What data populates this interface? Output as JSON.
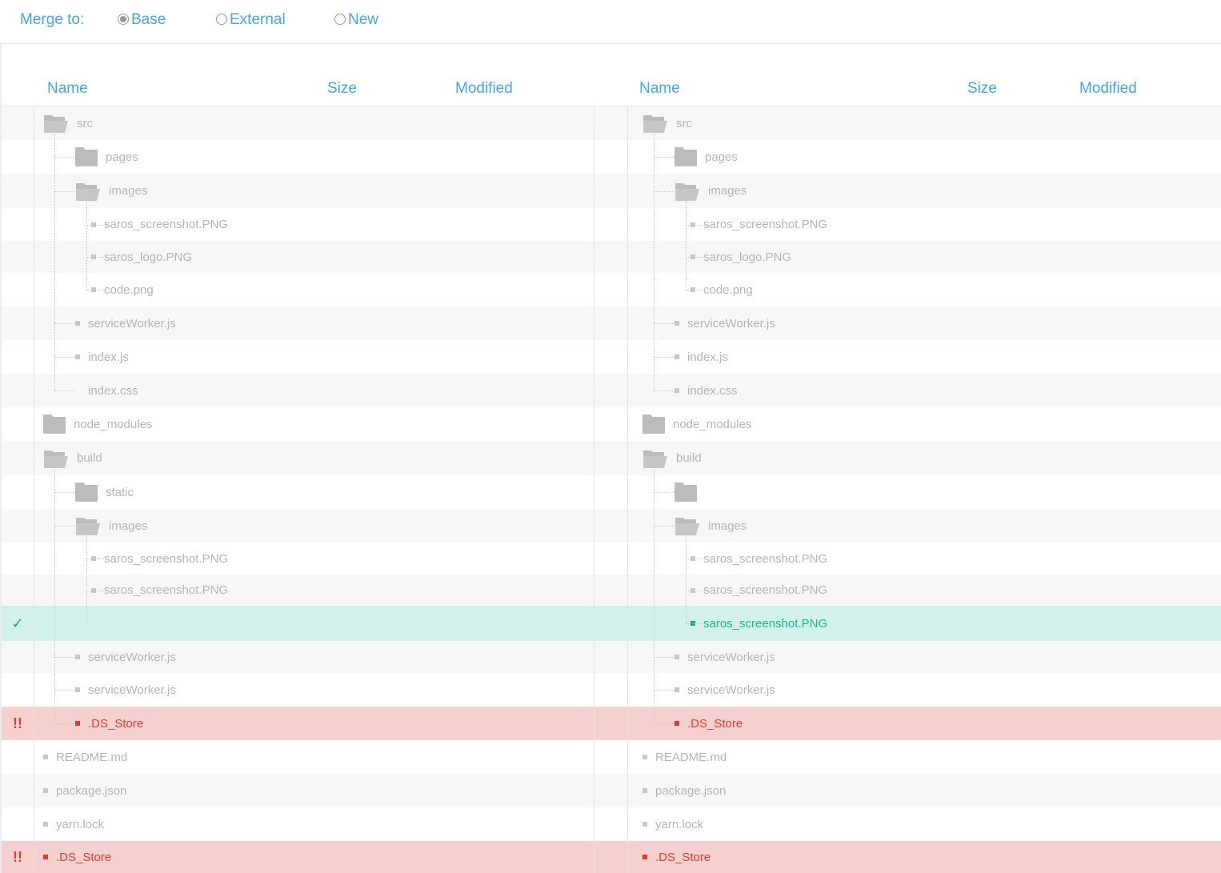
{
  "merge_bar": {
    "label": "Merge to:",
    "options": [
      {
        "label": "Base",
        "selected": true
      },
      {
        "label": "External",
        "selected": false
      },
      {
        "label": "New",
        "selected": false
      }
    ]
  },
  "columns": {
    "left": {
      "name": "Name",
      "size": "Size",
      "modified": "Modified"
    },
    "right": {
      "name": "Name",
      "size": "Size",
      "modified": "Modified"
    }
  },
  "status_marks": {
    "ok": "✓",
    "conflict": "!!"
  },
  "colors": {
    "accent": "#4aa3e6",
    "ok_row": "#d2f1ea",
    "ok_text": "#1ba386",
    "conflict_row": "#f4d0cf",
    "conflict_text": "#e03c31"
  },
  "rows": [
    {
      "left": "src",
      "right": "src",
      "type": "folder-open",
      "level": 0,
      "status": "none"
    },
    {
      "left": "pages",
      "right": "pages",
      "type": "folder",
      "level": 1,
      "status": "none"
    },
    {
      "left": "images",
      "right": "images",
      "type": "folder-open",
      "level": 1,
      "status": "none"
    },
    {
      "left": "saros_screenshot.PNG",
      "right": "saros_screenshot.PNG",
      "type": "file",
      "level": 2,
      "status": "none"
    },
    {
      "left": "saros_logo.PNG",
      "right": "saros_logo.PNG",
      "type": "file",
      "level": 2,
      "status": "none"
    },
    {
      "left": "code.png",
      "right": "code.png",
      "type": "file",
      "level": 2,
      "status": "none"
    },
    {
      "left": "serviceWorker.js",
      "right": "serviceWorker.js",
      "type": "file",
      "level": 1,
      "status": "none"
    },
    {
      "left": "index.js",
      "right": "index.js",
      "type": "file",
      "level": 1,
      "status": "none"
    },
    {
      "left": "index.css",
      "right": "index.css",
      "type": "file",
      "level": 1,
      "status": "none",
      "left_no_icon": true
    },
    {
      "left": "node_modules",
      "right": "node_modules",
      "type": "folder",
      "level": 0,
      "status": "none"
    },
    {
      "left": "build",
      "right": "build",
      "type": "folder-open",
      "level": 0,
      "status": "none"
    },
    {
      "left": "static",
      "right": "",
      "type": "folder",
      "level": 1,
      "status": "none"
    },
    {
      "left": "images",
      "right": "images",
      "type": "folder-open",
      "level": 1,
      "status": "none"
    },
    {
      "left": "saros_screenshot.PNG",
      "right": "saros_screenshot.PNG",
      "type": "file",
      "level": 2,
      "status": "none"
    },
    {
      "left": "saros_screenshot.PNG",
      "right": "saros_screenshot.PNG",
      "type": "file",
      "level": 2,
      "status": "none"
    },
    {
      "left": "",
      "right": "saros_screenshot.PNG",
      "type": "file",
      "level": 2,
      "status": "added"
    },
    {
      "left": "serviceWorker.js",
      "right": "serviceWorker.js",
      "type": "file",
      "level": 1,
      "status": "none"
    },
    {
      "left": "serviceWorker.js",
      "right": "serviceWorker.js",
      "type": "file",
      "level": 1,
      "status": "none"
    },
    {
      "left": ".DS_Store",
      "right": ".DS_Store",
      "type": "file",
      "level": 1,
      "status": "conflict"
    },
    {
      "left": "README.md",
      "right": "README.md",
      "type": "file",
      "level": 0,
      "status": "none"
    },
    {
      "left": "package.json",
      "right": "package.json",
      "type": "file",
      "level": 0,
      "status": "none"
    },
    {
      "left": "yarn.lock",
      "right": "yarn.lock",
      "type": "file",
      "level": 0,
      "status": "none"
    },
    {
      "left": ".DS_Store",
      "right": ".DS_Store",
      "type": "file",
      "level": 0,
      "status": "conflict"
    }
  ]
}
